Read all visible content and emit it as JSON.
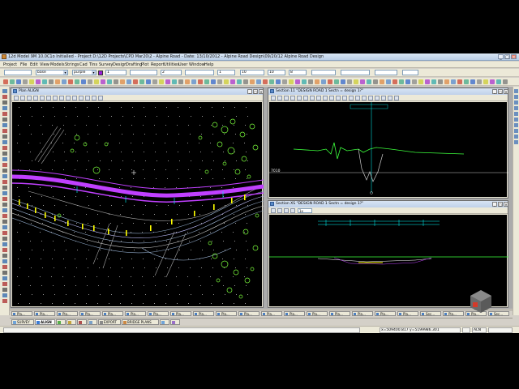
{
  "window": {
    "title": "12d Model 9M 10.0C1o Initialled - Project D:\\12D Projects\\CPD Mar20\\2 - Alpine Road - Date: 13/10/2012 - Alpine Road Design\\09/20/12 Alpine Road Design",
    "minimize": "_",
    "maximize": "□",
    "close": "✕"
  },
  "menu": [
    "Project",
    "File",
    "Edit",
    "View",
    "Models",
    "Strings",
    "Cad",
    "Tins",
    "Survey",
    "Design",
    "Drafting",
    "Plot",
    "Report",
    "Utilities",
    "User",
    "Window",
    "Help"
  ],
  "toolbar1": {
    "field1": "",
    "field2": "base",
    "field3": "purple",
    "field4": "1",
    "field5": "2",
    "field6": "1",
    "field7": "10",
    "field8": "10",
    "field9": "8"
  },
  "toolbar2": {},
  "panes": {
    "plan": {
      "title": "Plan ALIGN",
      "controls": [
        "_",
        "□",
        "✕"
      ]
    },
    "section1": {
      "title": "Section 11 \"DESIGN ROAD 1 Sectn = design 1?\" ",
      "controls": [
        "_",
        "□",
        "✕"
      ],
      "label_left": "7010"
    },
    "section2": {
      "title": "Section XS \"DESIGN ROAD 1 Sectn = design 1?\"",
      "controls": [
        "_",
        "□",
        "✕"
      ],
      "box": "1x"
    }
  },
  "taskbar": [
    "Pla...",
    "Pla...",
    "Pla...",
    "Pla...",
    "Pla...",
    "Pla...",
    "Pla...",
    "Pla...",
    "Pla...",
    "Pla...",
    "Pla...",
    "Pla...",
    "Pla...",
    "Pla...",
    "Pla...",
    "Pla...",
    "Pla...",
    "Pla...",
    "Sec...",
    "Pla...",
    "Pla...",
    "Sec..."
  ],
  "tabs": [
    {
      "label": "SURVEY",
      "active": false,
      "color": "#6fa3d8"
    },
    {
      "label": "ALIGN",
      "active": true,
      "color": "#3a7bd5"
    },
    {
      "label": "",
      "active": false,
      "color": "#56b04a"
    },
    {
      "label": "",
      "active": false,
      "color": "#c4a43a"
    },
    {
      "label": "",
      "active": false,
      "color": "#b05050"
    },
    {
      "label": "",
      "active": false,
      "color": "#7aa0c8"
    },
    {
      "label": "EXPORT",
      "active": false,
      "color": "#8a8a8a"
    },
    {
      "label": "BRIDGE PLANS",
      "active": false,
      "color": "#cc8844"
    },
    {
      "label": "",
      "active": false,
      "color": "#6fa3d8"
    },
    {
      "label": "",
      "active": false,
      "color": "#9a6fc8"
    }
  ],
  "status": {
    "coords": "x=509400.817 y=5199986.301",
    "flag": "ALN",
    "right": ""
  },
  "colors": {
    "design_string": "#c040ff",
    "ground_line": "#3cff3c",
    "section_line": "#ffffff",
    "cyan_axis": "#00ffff",
    "trees": "#7cff3c",
    "survey_yellow": "#ffff00"
  }
}
